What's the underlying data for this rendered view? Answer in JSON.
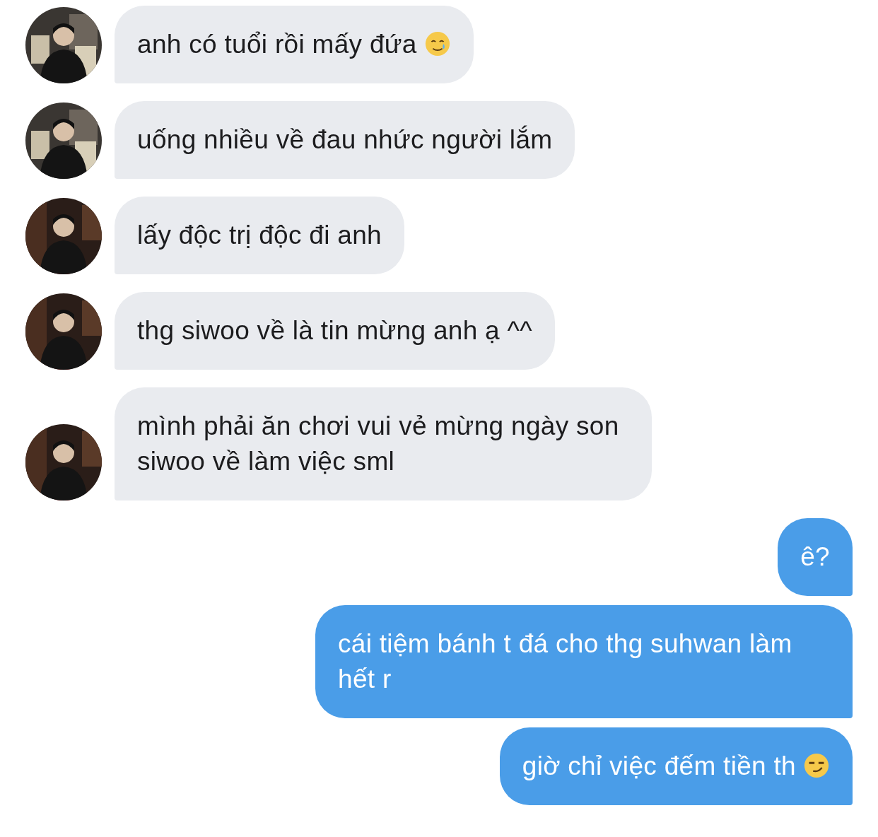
{
  "messages": [
    {
      "kind": "incoming",
      "text": "anh có tuổi rồi mấy đứa",
      "emoji": {
        "kind": "tear"
      }
    },
    {
      "kind": "incoming",
      "text": "uống nhiều về đau nhức người lắm"
    },
    {
      "kind": "incoming",
      "text": "lấy độc trị độc đi anh"
    },
    {
      "kind": "incoming",
      "text": "thg siwoo về là tin mừng anh ạ ^^"
    },
    {
      "kind": "incoming",
      "text": "mình phải ăn chơi vui vẻ mừng ngày son siwoo về làm việc sml"
    },
    {
      "kind": "outgoing",
      "text": "ê?"
    },
    {
      "kind": "outgoing",
      "text": "cái tiệm bánh t đá cho thg suhwan làm hết r"
    },
    {
      "kind": "outgoing",
      "text": "giờ chỉ việc đếm tiền th",
      "emoji": {
        "kind": "smirk"
      }
    }
  ]
}
